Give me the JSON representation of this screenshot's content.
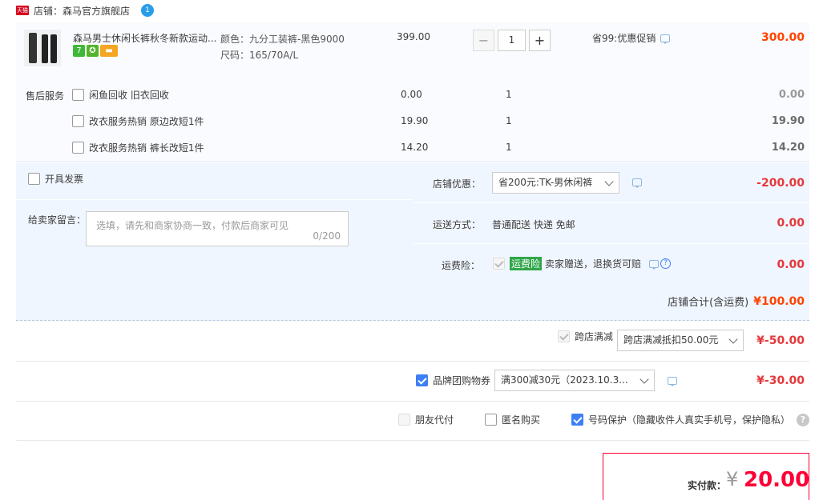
{
  "shop": {
    "badge": "天猫",
    "label": "店铺：",
    "name": "森马官方旗舰店",
    "im_badge": "1"
  },
  "item": {
    "title": "森马男士休闲长裤秋冬新款运动...",
    "sku_color": "颜色：九分工装裤-黑色9000",
    "sku_size": "尺码：165/70A/L",
    "price": "399.00",
    "quantity": "1",
    "minus": "−",
    "plus": "+",
    "promo": "省99:优惠促销",
    "total": "300.00",
    "tags": [
      {
        "icon": "seven-day-return-icon",
        "text": "7",
        "color": "#3fb838"
      },
      {
        "icon": "medal-icon",
        "text": "✪",
        "color": "#52b52a"
      },
      {
        "icon": "card-icon",
        "text": "▬",
        "color": "#f5a623"
      }
    ]
  },
  "services": {
    "label": "售后服务",
    "rows": [
      {
        "name": "闲鱼回收  旧衣回收",
        "price": "0.00",
        "qty": "1",
        "total": "0.00"
      },
      {
        "name": "改衣服务热销  原边改短1件",
        "price": "19.90",
        "qty": "1",
        "total": "19.90"
      },
      {
        "name": "改衣服务热销  裤长改短1件",
        "price": "14.20",
        "qty": "1",
        "total": "14.20"
      }
    ]
  },
  "invoice": {
    "label": "开具发票"
  },
  "message": {
    "label": "给卖家留言：",
    "placeholder": "选填，请先和商家协商一致，付款后商家可见",
    "count": "0/200"
  },
  "shop_discount": {
    "label": "店铺优惠：",
    "selected": "省200元:TK-男休闲裤",
    "amount": "-200.00"
  },
  "shipping": {
    "label": "运送方式：",
    "value": "普通配送 快递 免邮",
    "amount": "0.00"
  },
  "insurance": {
    "label": "运费险：",
    "tag": "运费险",
    "desc": "卖家赠送，退换货可赔",
    "amount": "0.00"
  },
  "shop_total": {
    "label": "店铺合计(含运费)",
    "amount": "¥100.00"
  },
  "cross_store": {
    "label": "跨店满减",
    "selected": "跨店满减抵扣50.00元",
    "amount": "¥-50.00"
  },
  "brand_coupon": {
    "label": "品牌团购物券",
    "selected": "满300减30元（2023.10.3...",
    "amount": "¥-30.00"
  },
  "options": {
    "friend_pay": "朋友代付",
    "anonymous": "匿名购买",
    "privacy": "号码保护（隐藏收件人真实手机号，保护隐私）",
    "help": "?"
  },
  "payment": {
    "label": "实付款：",
    "currency": "¥",
    "amount": "20.00"
  }
}
